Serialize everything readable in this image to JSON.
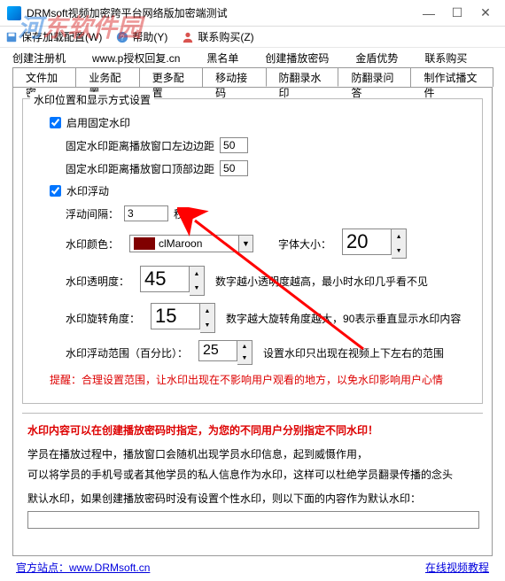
{
  "window": {
    "title": "DRMsoft视频加密跨平台网络版加密端测试",
    "min": "—",
    "max": "☐",
    "close": "✕"
  },
  "watermark": {
    "text1": "河",
    "text2": "东软件园"
  },
  "menubar": {
    "save": "保存加载配置(W)",
    "help": "帮助(Y)",
    "buy": "联系购买(Z)"
  },
  "toolbar": {
    "items": [
      "创建注册机",
      "www.p授权回复.cn",
      "黑名单",
      "创建播放密码",
      "金盾优势",
      "联系购买"
    ]
  },
  "tabs": {
    "items": [
      "文件加密",
      "业务配置",
      "更多配置",
      "移动接码",
      "防翻录水印",
      "防翻录问答",
      "制作试播文件"
    ],
    "active": 4
  },
  "group": {
    "title": "水印位置和显示方式设置",
    "fixed": {
      "enable": "启用固定水印",
      "left_label": "固定水印距离播放窗口左边边距",
      "left_val": "50",
      "top_label": "固定水印距离播放窗口顶部边距",
      "top_val": "50"
    },
    "float": {
      "enable": "水印浮动",
      "interval_label": "浮动间隔：",
      "interval_val": "3",
      "interval_unit": "秒",
      "color_label": "水印颜色：",
      "color_name": "clMaroon",
      "fontsize_label": "字体大小：",
      "fontsize_val": "20",
      "opacity_label": "水印透明度：",
      "opacity_val": "45",
      "opacity_hint": "数字越小透明度越高，最小时水印几乎看不见",
      "rotate_label": "水印旋转角度：",
      "rotate_val": "15",
      "rotate_hint": "数字越大旋转角度越大，90表示垂直显示水印内容",
      "range_label": "水印浮动范围（百分比）：",
      "range_val": "25",
      "range_hint": "设置水印只出现在视频上下左右的范围",
      "warn": "提醒：合理设置范围，让水印出现在不影响用户观看的地方，以免水印影响用户心情"
    }
  },
  "bottom": {
    "red": "水印内容可以在创建播放密码时指定，为您的不同用户分别指定不同水印！",
    "line1": "学员在播放过程中，播放窗口会随机出现学员水印信息，起到威慑作用，",
    "line2": "可以将学员的手机号或者其他学员的私人信息作为水印，这样可以杜绝学员翻录传播的念头",
    "default_label": "默认水印，如果创建播放密码时没有设置个性水印，则以下面的内容作为默认水印：",
    "default_val": ""
  },
  "footer": {
    "left_pre": "官方站点：",
    "left_link": "www.DRMsoft.cn",
    "right_link": "在线视频教程"
  }
}
